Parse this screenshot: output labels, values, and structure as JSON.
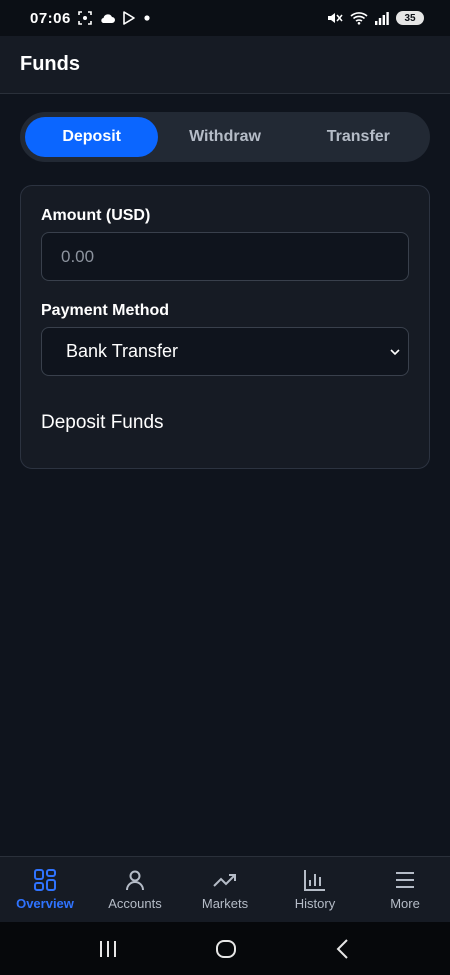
{
  "status_bar": {
    "time": "07:06",
    "battery": "35",
    "left_icons": [
      "screenshot-icon",
      "cloud-icon",
      "play-store-icon",
      "dot-icon"
    ],
    "right_icons": [
      "mute-icon",
      "wifi-icon",
      "signal-icon",
      "battery-icon"
    ]
  },
  "header": {
    "title": "Funds"
  },
  "tabs": [
    {
      "label": "Deposit",
      "active": true
    },
    {
      "label": "Withdraw",
      "active": false
    },
    {
      "label": "Transfer",
      "active": false
    }
  ],
  "form": {
    "amount_label": "Amount (USD)",
    "amount_placeholder": "0.00",
    "payment_label": "Payment Method",
    "payment_value": "Bank Transfer",
    "submit_label": "Deposit Funds"
  },
  "bottom_nav": [
    {
      "label": "Overview",
      "icon": "grid-icon",
      "active": true
    },
    {
      "label": "Accounts",
      "icon": "user-icon",
      "active": false
    },
    {
      "label": "Markets",
      "icon": "trend-icon",
      "active": false
    },
    {
      "label": "History",
      "icon": "bar-chart-icon",
      "active": false
    },
    {
      "label": "More",
      "icon": "menu-icon",
      "active": false
    }
  ],
  "colors": {
    "accent": "#0b66ff",
    "background": "#0f141d",
    "surface": "#161b24"
  }
}
